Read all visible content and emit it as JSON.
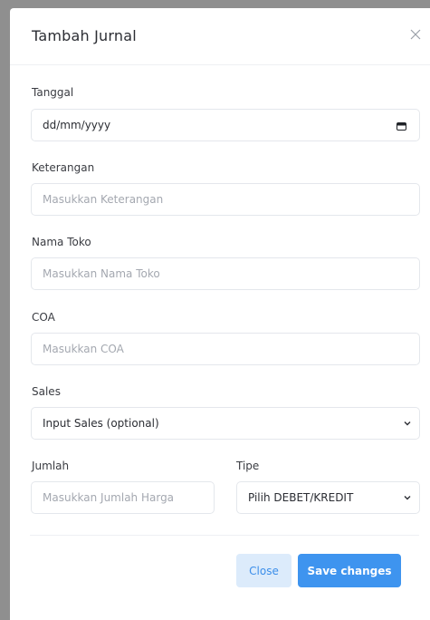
{
  "modal": {
    "title": "Tambah Jurnal"
  },
  "fields": {
    "tanggal": {
      "label": "Tanggal",
      "value": "dd/mm/yyyy"
    },
    "keterangan": {
      "label": "Keterangan",
      "placeholder": "Masukkan Keterangan"
    },
    "nama_toko": {
      "label": "Nama Toko",
      "placeholder": "Masukkan Nama Toko"
    },
    "coa": {
      "label": "COA",
      "placeholder": "Masukkan COA"
    },
    "sales": {
      "label": "Sales",
      "selected": "Input Sales (optional)"
    },
    "jumlah": {
      "label": "Jumlah",
      "placeholder": "Masukkan Jumlah Harga"
    },
    "tipe": {
      "label": "Tipe",
      "selected": "Pilih DEBET/KREDIT"
    }
  },
  "footer": {
    "close_label": "Close",
    "save_label": "Save changes"
  },
  "colors": {
    "accent": "#3e94ef",
    "accent_light": "#dcebfb"
  },
  "icons": {
    "close": "close-icon",
    "calendar": "calendar-icon",
    "dropdown": "chevron-down-icon"
  }
}
